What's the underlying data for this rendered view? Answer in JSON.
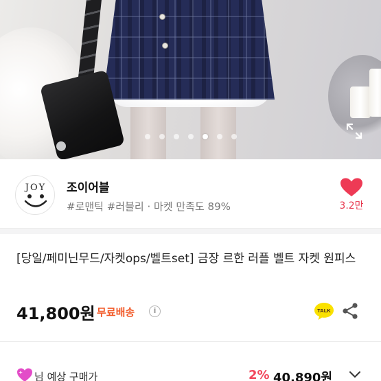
{
  "gallery": {
    "image_count": 7,
    "active_index": 4
  },
  "seller": {
    "name": "조이어블",
    "tags": "#로맨틱 #러블리 · 마켓 만족도 89%",
    "avatar_text": "JOY",
    "likes": "3.2만"
  },
  "product": {
    "title": "[당일/페미닌무드/자켓ops/벨트set] 금장 르한 러플 벨트 자켓 원피스",
    "price": "41,800원",
    "shipping": "무료배송",
    "talk_label": "TALK"
  },
  "expected": {
    "label": "님 예상 구매가",
    "discount": "2%",
    "price": "40,890원"
  },
  "colors": {
    "accent": "#e8384f",
    "shipping": "#f25a29",
    "talk": "#fae100"
  }
}
